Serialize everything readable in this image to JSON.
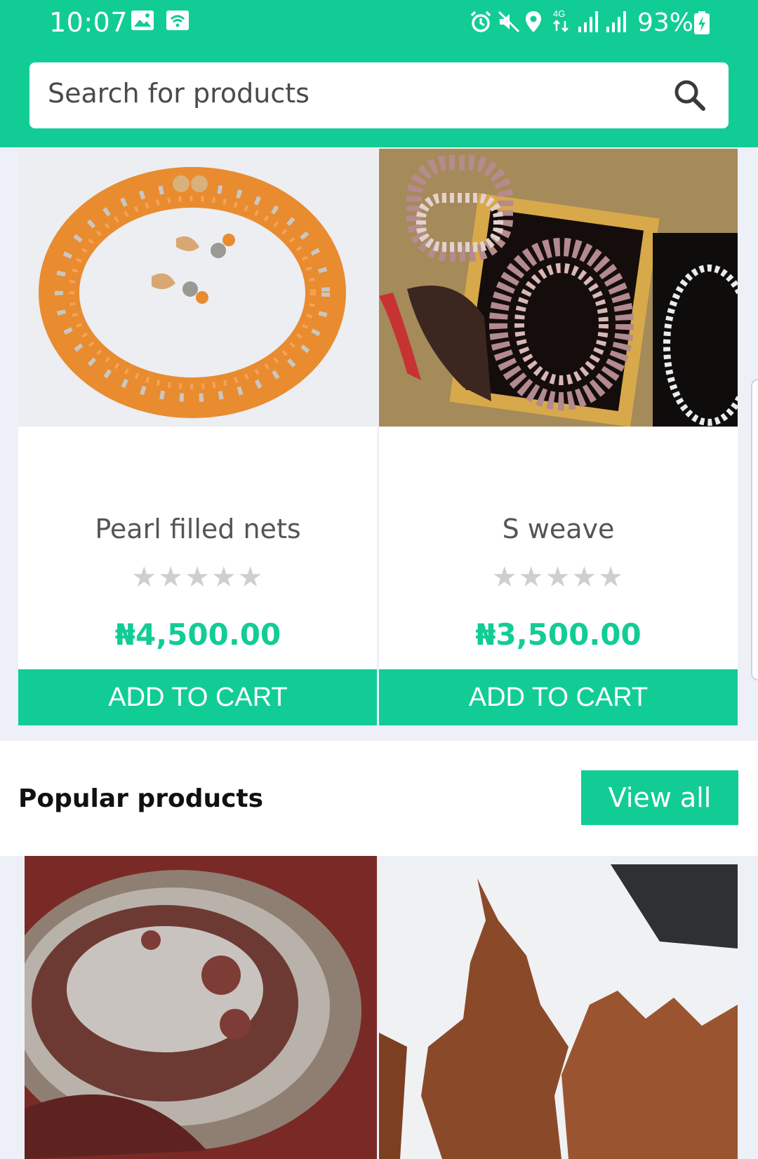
{
  "status_bar": {
    "time": "10:07",
    "battery": "93%",
    "icons": [
      "image-icon",
      "wifi-icon",
      "alarm-icon",
      "mute-icon",
      "location-icon",
      "4g-icon",
      "signal-icon",
      "signal-icon",
      "battery-charging-icon"
    ]
  },
  "search": {
    "placeholder": "Search for products",
    "icon": "search-icon"
  },
  "products": [
    {
      "name": "Pearl filled nets",
      "rating": 0,
      "max_rating": 5,
      "stars": "★★★★★",
      "price": "₦4,500.00",
      "cta": "ADD TO CART"
    },
    {
      "name": "S weave",
      "rating": 0,
      "max_rating": 5,
      "stars": "★★★★★",
      "price": "₦3,500.00",
      "cta": "ADD TO CART"
    }
  ],
  "popular": {
    "title": "Popular products",
    "view_all": "View all"
  },
  "colors": {
    "accent": "#12cc96",
    "background": "#eef0f7",
    "card": "#ffffff",
    "star_inactive": "#cfcfcf"
  }
}
